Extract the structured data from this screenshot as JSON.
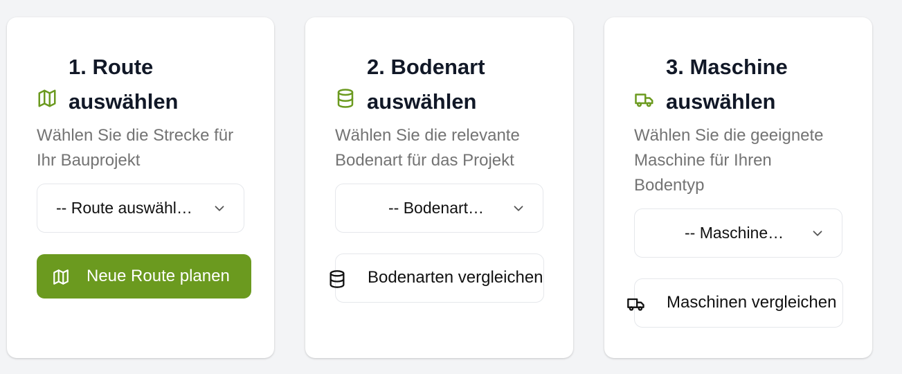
{
  "colors": {
    "accent": "#6b9a1f",
    "background": "#f3f4f6",
    "card": "#ffffff",
    "title": "#111827",
    "description": "#737373"
  },
  "cards": [
    {
      "icon": "map-icon",
      "title_line1": "1. Route",
      "title_line2": "auswählen",
      "description": "Wählen Sie die Strecke für Ihr Bauprojekt",
      "select_value": "-- Route auswähl…",
      "button_label": "Neue Route planen",
      "button_icon": "map-icon"
    },
    {
      "icon": "database-icon",
      "title_line1": "2. Bodenart",
      "title_line2": "auswählen",
      "description": "Wählen Sie die relevante Bodenart für das Projekt",
      "select_value": "-- Bodenart…",
      "button_label": "Bodenarten vergleichen",
      "button_icon": "database-icon"
    },
    {
      "icon": "truck-icon",
      "title_line1": "3. Maschine",
      "title_line2": "auswählen",
      "description": "Wählen Sie die geeignete Maschine für Ihren Bodentyp",
      "select_value": "-- Maschine…",
      "button_label": "Maschinen vergleichen",
      "button_icon": "truck-icon"
    }
  ]
}
